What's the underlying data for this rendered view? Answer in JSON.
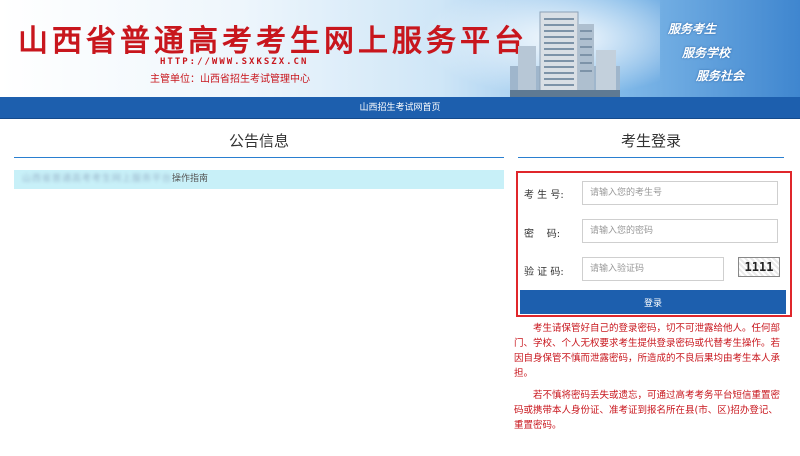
{
  "banner": {
    "title": "山西省普通高考考生网上服务平台",
    "url": "HTTP://WWW.SXKSZX.CN",
    "org": "主管单位：山西省招生考试管理中心",
    "slogans": [
      "服务考生",
      "服务学校",
      "服务社会"
    ]
  },
  "nav": {
    "home_link": "山西招生考试网首页"
  },
  "notice": {
    "heading": "公告信息",
    "items": [
      {
        "blurred_text": "山西省普通高考考生网上服务平台",
        "text": "操作指南"
      }
    ]
  },
  "login": {
    "heading": "考生登录",
    "exam_no_label": "考 生 号:",
    "exam_no_placeholder": "请输入您的考生号",
    "password_label": "密    码:",
    "password_placeholder": "请输入您的密码",
    "captcha_label": "验 证 码:",
    "captcha_placeholder": "请输入验证码",
    "captcha_text": "1111",
    "submit_label": "登录"
  },
  "warnings": {
    "p1": "考生请保管好自己的登录密码，切不可泄露给他人。任何部门、学校、个人无权要求考生提供登录密码或代替考生操作。若因自身保管不慎而泄露密码，所造成的不良后果均由考生本人承担。",
    "p2": "若不慎将密码丢失或遗忘，可通过高考考务平台短信重置密码或携带本人身份证、准考证到报名所在县(市、区)招办登记、重置密码。"
  },
  "colors": {
    "brand_red": "#c8161d",
    "nav_blue": "#1d5fae",
    "accent_line": "#2a7fd0",
    "notice_highlight": "#c8f0f8"
  }
}
